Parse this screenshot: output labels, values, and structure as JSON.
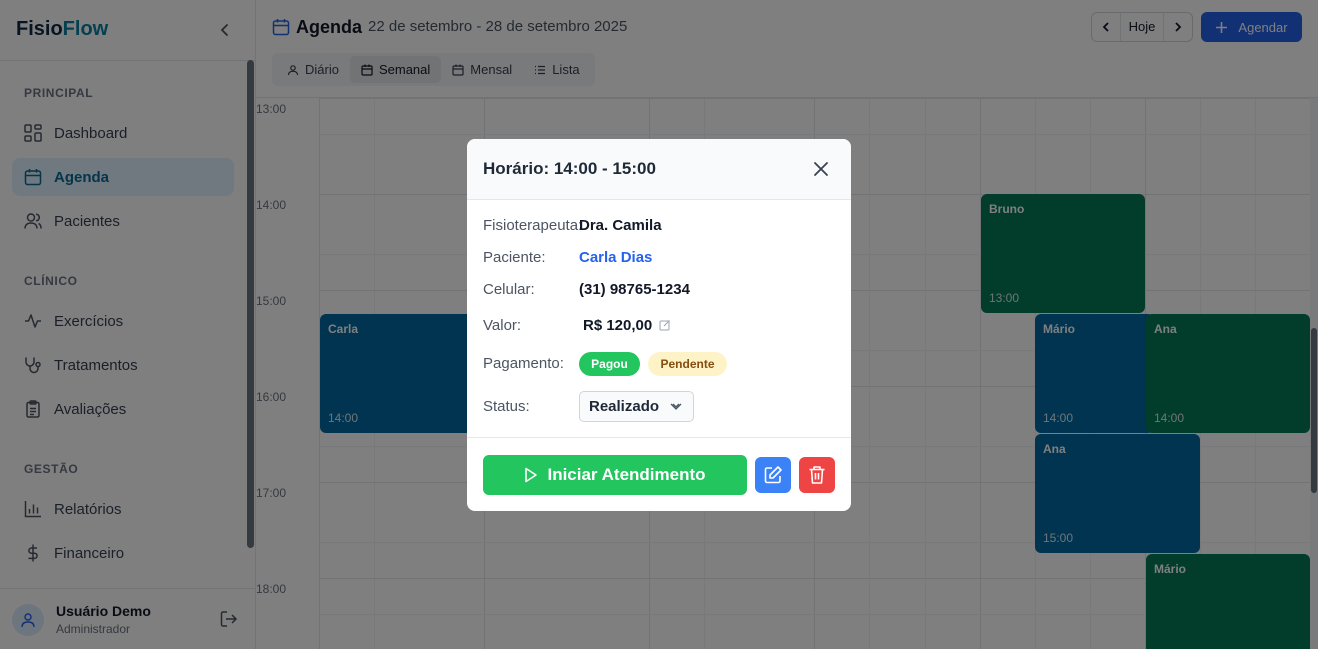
{
  "app": {
    "logo_part1": "Fisio",
    "logo_part2": "Flow",
    "brand_color": "#0a7ea4"
  },
  "sidebar": {
    "sections": [
      {
        "label": "PRINCIPAL"
      },
      {
        "label": "CLÍNICO"
      },
      {
        "label": "GESTÃO"
      }
    ],
    "items": [
      {
        "label": "Dashboard",
        "icon": "grid-icon"
      },
      {
        "label": "Agenda",
        "icon": "calendar-icon",
        "active": true
      },
      {
        "label": "Pacientes",
        "icon": "users-icon"
      },
      {
        "label": "Exercícios",
        "icon": "activity-icon"
      },
      {
        "label": "Tratamentos",
        "icon": "stethoscope-icon"
      },
      {
        "label": "Avaliações",
        "icon": "clipboard-icon"
      },
      {
        "label": "Relatórios",
        "icon": "bar-chart-icon"
      },
      {
        "label": "Financeiro",
        "icon": "dollar-icon"
      }
    ],
    "user": {
      "name": "Usuário Demo",
      "role": "Administrador"
    }
  },
  "header": {
    "title": "Agenda",
    "date_range": "22 de setembro - 28 de setembro 2025",
    "today_label": "Hoje",
    "new_button_label": "Agendar",
    "tabs": [
      {
        "label": "Diário"
      },
      {
        "label": "Semanal",
        "active": true
      },
      {
        "label": "Mensal"
      },
      {
        "label": "Lista"
      }
    ]
  },
  "calendar": {
    "hours": [
      "13:00",
      "14:00",
      "15:00",
      "16:00",
      "17:00",
      "18:00"
    ],
    "events": [
      {
        "name": "Bruno",
        "time": "13:00",
        "color": "#047857"
      },
      {
        "name": "Carla",
        "time": "14:00",
        "color": "#0369a1"
      },
      {
        "name": "Mário",
        "time": "14:00",
        "color": "#0369a1"
      },
      {
        "name": "Ana",
        "time": "14:00",
        "color": "#047857"
      },
      {
        "name": "Ana",
        "time": "15:00",
        "color": "#0369a1"
      },
      {
        "name": "Mário",
        "time": "",
        "color": "#047857"
      }
    ]
  },
  "modal": {
    "title": "Horário: 14:00 - 15:00",
    "fields": {
      "therapist_label": "Fisioterapeuta:",
      "therapist_value": "Dra. Camila",
      "patient_label": "Paciente:",
      "patient_value": "Carla Dias",
      "phone_label": "Celular:",
      "phone_value": "(31) 98765-1234",
      "value_label": "Valor:",
      "value_value": "R$ 120,00",
      "payment_label": "Pagamento:",
      "payment_paid": "Pagou",
      "payment_pending": "Pendente",
      "status_label": "Status:",
      "status_value": "Realizado"
    },
    "start_button_label": "Iniciar Atendimento",
    "colors": {
      "start": "#22c55e",
      "edit": "#3b82f6",
      "delete": "#ef4444"
    }
  }
}
